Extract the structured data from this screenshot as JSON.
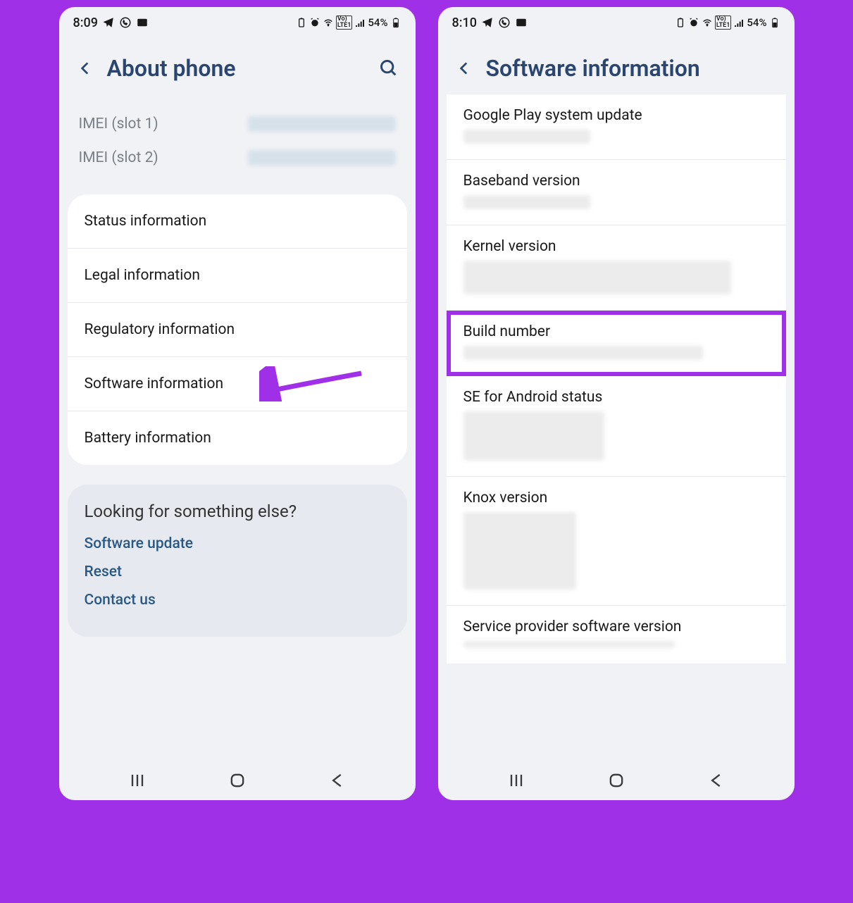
{
  "left": {
    "status": {
      "time": "8:09",
      "battery": "54%"
    },
    "header": {
      "title": "About phone"
    },
    "imei": [
      {
        "label": "IMEI (slot 1)"
      },
      {
        "label": "IMEI (slot 2)"
      }
    ],
    "items": [
      "Status information",
      "Legal information",
      "Regulatory information",
      "Software information",
      "Battery information"
    ],
    "footer": {
      "title": "Looking for something else?",
      "links": [
        "Software update",
        "Reset",
        "Contact us"
      ]
    }
  },
  "right": {
    "status": {
      "time": "8:10",
      "battery": "54%"
    },
    "header": {
      "title": "Software information"
    },
    "items": [
      {
        "title": "Google Play system update",
        "blur": "short"
      },
      {
        "title": "Baseband version",
        "blur": "short"
      },
      {
        "title": "Kernel version",
        "blur": "tall"
      },
      {
        "title": "Build number",
        "blur": "short",
        "highlighted": true
      },
      {
        "title": "SE for Android status",
        "blur": "tall"
      },
      {
        "title": "Knox version",
        "blur": "taller"
      },
      {
        "title": "Service provider software version",
        "blur": "short"
      }
    ]
  }
}
